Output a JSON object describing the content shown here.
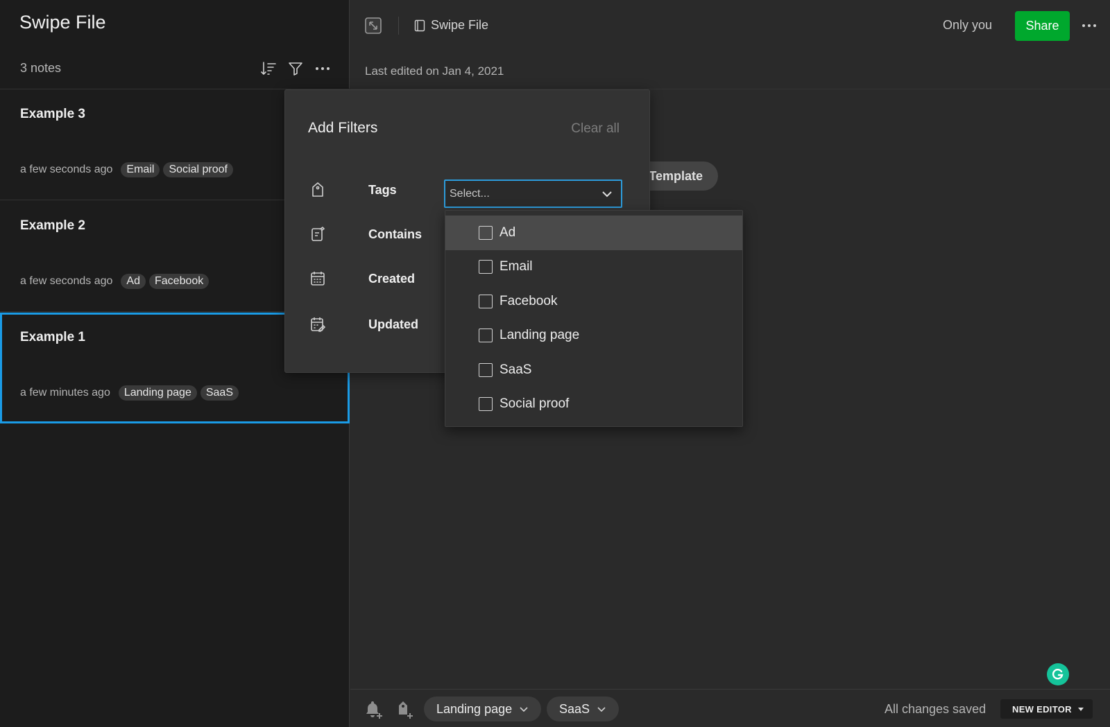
{
  "sidebar": {
    "title": "Swipe File",
    "count": "3 notes",
    "notes": [
      {
        "title": "Example 3",
        "time": "a few seconds ago",
        "tags": [
          "Email",
          "Social proof"
        ]
      },
      {
        "title": "Example 2",
        "time": "a few seconds ago",
        "tags": [
          "Ad",
          "Facebook"
        ]
      },
      {
        "title": "Example 1",
        "time": "a few minutes ago",
        "tags": [
          "Landing page",
          "SaaS"
        ]
      }
    ]
  },
  "header": {
    "notebook": "Swipe File",
    "visibility": "Only you",
    "share_label": "Share",
    "last_edited": "Last edited on Jan 4, 2021"
  },
  "editor": {
    "template_label": "Template"
  },
  "filters": {
    "title": "Add Filters",
    "clear_all": "Clear all",
    "rows": [
      "Tags",
      "Contains",
      "Created",
      "Updated"
    ],
    "select_placeholder": "Select..."
  },
  "dropdown": {
    "options": [
      "Ad",
      "Email",
      "Facebook",
      "Landing page",
      "SaaS",
      "Social proof"
    ]
  },
  "footer": {
    "tags": [
      "Landing page",
      "SaaS"
    ],
    "status": "All changes saved",
    "new_editor": "NEW EDITOR"
  },
  "colors": {
    "accent": "#2d9cdb",
    "share_green": "#00a82d",
    "selected_border": "#1a9be6",
    "grammarly": "#15c39a"
  }
}
